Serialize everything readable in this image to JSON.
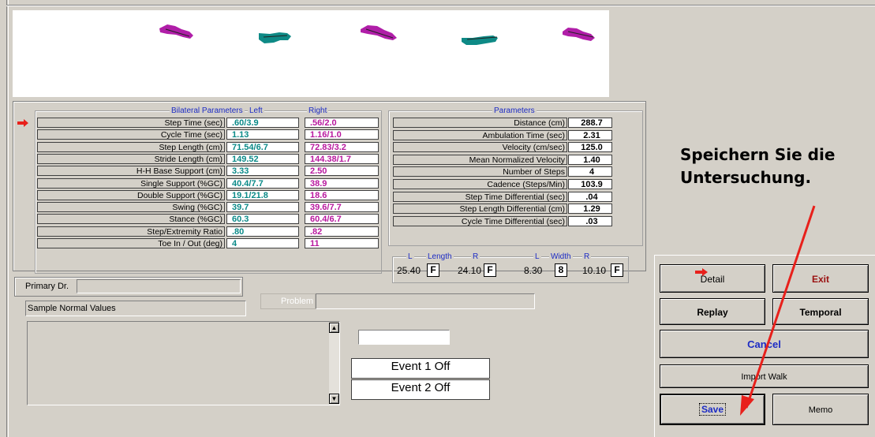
{
  "bilateral": {
    "title": "Bilateral Parameters",
    "left_header": "Left",
    "right_header": "Right",
    "rows": [
      {
        "label": "Step Time (sec)",
        "left": ".60/3.9",
        "right": ".56/2.0"
      },
      {
        "label": "Cycle Time (sec)",
        "left": "1.13",
        "right": "1.16/1.0"
      },
      {
        "label": "Step Length (cm)",
        "left": "71.54/6.7",
        "right": "72.83/3.2"
      },
      {
        "label": "Stride Length (cm)",
        "left": "149.52",
        "right": "144.38/1.7"
      },
      {
        "label": "H-H Base Support (cm)",
        "left": "3.33",
        "right": "2.50"
      },
      {
        "label": "Single Support (%GC)",
        "left": "40.4/7.7",
        "right": "38.9"
      },
      {
        "label": "Double Support (%GC)",
        "left": "19.1/21.8",
        "right": "18.6"
      },
      {
        "label": "Swing (%GC)",
        "left": "39.7",
        "right": "39.6/7.7"
      },
      {
        "label": "Stance (%GC)",
        "left": "60.3",
        "right": "60.4/6.7"
      },
      {
        "label": "Step/Extremity Ratio",
        "left": ".80",
        "right": ".82"
      },
      {
        "label": "Toe In / Out (deg)",
        "left": "4",
        "right": "11"
      }
    ]
  },
  "parameters": {
    "title": "Parameters",
    "rows": [
      {
        "label": "Distance (cm)",
        "value": "288.7"
      },
      {
        "label": "Ambulation Time (sec)",
        "value": "2.31"
      },
      {
        "label": "Velocity (cm/sec)",
        "value": "125.0"
      },
      {
        "label": "Mean Normalized Velocity",
        "value": "1.40"
      },
      {
        "label": "Number of Steps",
        "value": "4"
      },
      {
        "label": "Cadence (Steps/Min)",
        "value": "103.9"
      },
      {
        "label": "Step Time Differential (sec)",
        "value": ".04"
      },
      {
        "label": "Step Length Differential (cm)",
        "value": "1.29"
      },
      {
        "label": "Cycle Time Differential (sec)",
        "value": ".03"
      }
    ]
  },
  "foot_dims": {
    "length_title": "Length",
    "width_title": "Width",
    "l": "L",
    "r": "R",
    "length_left": "25.40",
    "length_left_flag": "F",
    "length_right": "24.10",
    "length_right_flag": "F",
    "width_left": "8.30",
    "width_left_flag": "8",
    "width_right": "10.10",
    "width_right_flag": "F"
  },
  "primary_dr": {
    "label": "Primary Dr.",
    "value": ""
  },
  "normals": "Sample Normal Values",
  "problem": {
    "label": "Problem",
    "value": ""
  },
  "events": {
    "event1": "Event 1 Off",
    "event2": "Event 2 Off"
  },
  "buttons": {
    "detail": "Detail",
    "exit": "Exit",
    "replay": "Replay",
    "temporal": "Temporal",
    "cancel": "Cancel",
    "import_walk": "Import Walk",
    "save": "Save",
    "memo": "Memo"
  },
  "annotation": "Speichern Sie die Untersuchung.",
  "colors": {
    "left": "#0a8a88",
    "right": "#b8179e",
    "arrow": "#e8201b",
    "title": "#1c2bc4"
  }
}
